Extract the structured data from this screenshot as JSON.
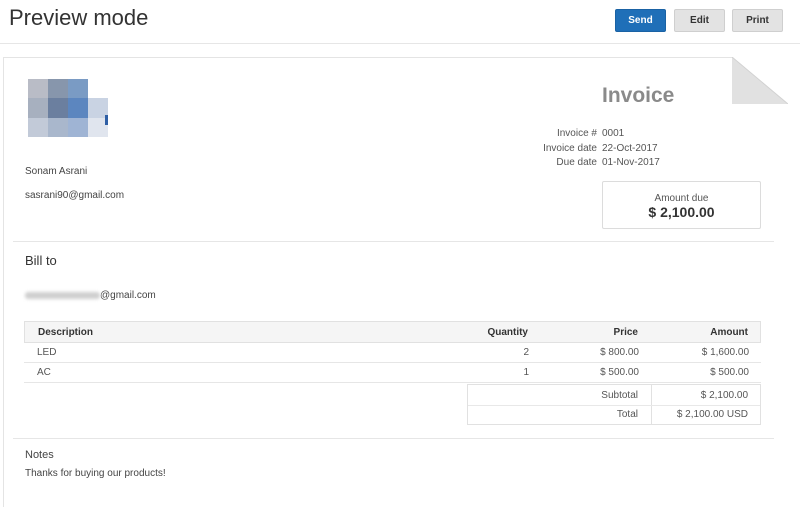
{
  "header": {
    "title": "Preview mode",
    "send_label": "Send",
    "edit_label": "Edit",
    "print_label": "Print",
    "send_color": "#1f6fb8"
  },
  "logo": {
    "pixels": [
      "#b9bcc6",
      "#8796ac",
      "#7a9bc4",
      "#ffffff",
      "#a7b0bf",
      "#6b7f9f",
      "#5c86bf",
      "#c9d3e3",
      "#c2cad8",
      "#a9b7cc",
      "#9fb4d4",
      "#e0e5ee"
    ],
    "accent": "#2f5fa5"
  },
  "seller": {
    "name": "Sonam Asrani",
    "email": "sasrani90@gmail.com"
  },
  "invoice": {
    "heading": "Invoice",
    "meta": [
      {
        "label": "Invoice #",
        "value": "0001"
      },
      {
        "label": "Invoice date",
        "value": "22-Oct-2017"
      },
      {
        "label": "Due date",
        "value": "01-Nov-2017"
      }
    ],
    "amount_due_label": "Amount due",
    "amount_due_value": "$ 2,100.00"
  },
  "bill_to": {
    "title": "Bill to",
    "email_domain": "@gmail.com"
  },
  "items_table": {
    "columns": {
      "description": "Description",
      "quantity": "Quantity",
      "price": "Price",
      "amount": "Amount"
    },
    "rows": [
      {
        "description": "LED",
        "quantity": "2",
        "price": "$ 800.00",
        "amount": "$ 1,600.00"
      },
      {
        "description": "AC",
        "quantity": "1",
        "price": "$ 500.00",
        "amount": "$ 500.00"
      }
    ]
  },
  "totals": {
    "subtotal_label": "Subtotal",
    "subtotal_value": "$ 2,100.00",
    "total_label": "Total",
    "total_value": "$ 2,100.00 USD"
  },
  "notes": {
    "title": "Notes",
    "text": "Thanks for buying our products!"
  }
}
